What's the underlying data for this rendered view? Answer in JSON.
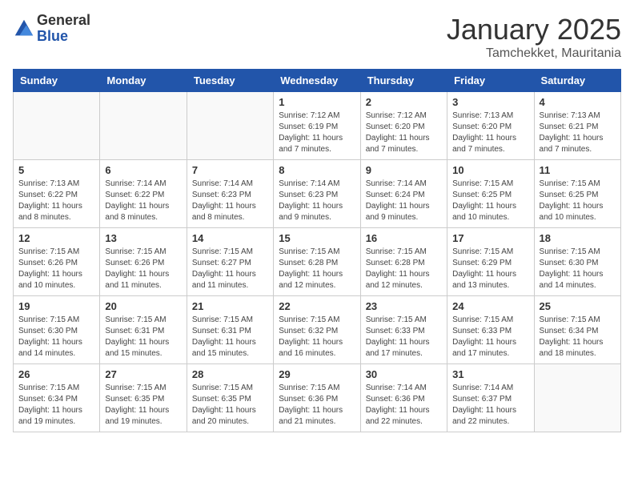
{
  "logo": {
    "general": "General",
    "blue": "Blue"
  },
  "title": "January 2025",
  "location": "Tamchekket, Mauritania",
  "days_of_week": [
    "Sunday",
    "Monday",
    "Tuesday",
    "Wednesday",
    "Thursday",
    "Friday",
    "Saturday"
  ],
  "weeks": [
    [
      {
        "day": "",
        "info": ""
      },
      {
        "day": "",
        "info": ""
      },
      {
        "day": "",
        "info": ""
      },
      {
        "day": "1",
        "info": "Sunrise: 7:12 AM\nSunset: 6:19 PM\nDaylight: 11 hours\nand 7 minutes."
      },
      {
        "day": "2",
        "info": "Sunrise: 7:12 AM\nSunset: 6:20 PM\nDaylight: 11 hours\nand 7 minutes."
      },
      {
        "day": "3",
        "info": "Sunrise: 7:13 AM\nSunset: 6:20 PM\nDaylight: 11 hours\nand 7 minutes."
      },
      {
        "day": "4",
        "info": "Sunrise: 7:13 AM\nSunset: 6:21 PM\nDaylight: 11 hours\nand 7 minutes."
      }
    ],
    [
      {
        "day": "5",
        "info": "Sunrise: 7:13 AM\nSunset: 6:22 PM\nDaylight: 11 hours\nand 8 minutes."
      },
      {
        "day": "6",
        "info": "Sunrise: 7:14 AM\nSunset: 6:22 PM\nDaylight: 11 hours\nand 8 minutes."
      },
      {
        "day": "7",
        "info": "Sunrise: 7:14 AM\nSunset: 6:23 PM\nDaylight: 11 hours\nand 8 minutes."
      },
      {
        "day": "8",
        "info": "Sunrise: 7:14 AM\nSunset: 6:23 PM\nDaylight: 11 hours\nand 9 minutes."
      },
      {
        "day": "9",
        "info": "Sunrise: 7:14 AM\nSunset: 6:24 PM\nDaylight: 11 hours\nand 9 minutes."
      },
      {
        "day": "10",
        "info": "Sunrise: 7:15 AM\nSunset: 6:25 PM\nDaylight: 11 hours\nand 10 minutes."
      },
      {
        "day": "11",
        "info": "Sunrise: 7:15 AM\nSunset: 6:25 PM\nDaylight: 11 hours\nand 10 minutes."
      }
    ],
    [
      {
        "day": "12",
        "info": "Sunrise: 7:15 AM\nSunset: 6:26 PM\nDaylight: 11 hours\nand 10 minutes."
      },
      {
        "day": "13",
        "info": "Sunrise: 7:15 AM\nSunset: 6:26 PM\nDaylight: 11 hours\nand 11 minutes."
      },
      {
        "day": "14",
        "info": "Sunrise: 7:15 AM\nSunset: 6:27 PM\nDaylight: 11 hours\nand 11 minutes."
      },
      {
        "day": "15",
        "info": "Sunrise: 7:15 AM\nSunset: 6:28 PM\nDaylight: 11 hours\nand 12 minutes."
      },
      {
        "day": "16",
        "info": "Sunrise: 7:15 AM\nSunset: 6:28 PM\nDaylight: 11 hours\nand 12 minutes."
      },
      {
        "day": "17",
        "info": "Sunrise: 7:15 AM\nSunset: 6:29 PM\nDaylight: 11 hours\nand 13 minutes."
      },
      {
        "day": "18",
        "info": "Sunrise: 7:15 AM\nSunset: 6:30 PM\nDaylight: 11 hours\nand 14 minutes."
      }
    ],
    [
      {
        "day": "19",
        "info": "Sunrise: 7:15 AM\nSunset: 6:30 PM\nDaylight: 11 hours\nand 14 minutes."
      },
      {
        "day": "20",
        "info": "Sunrise: 7:15 AM\nSunset: 6:31 PM\nDaylight: 11 hours\nand 15 minutes."
      },
      {
        "day": "21",
        "info": "Sunrise: 7:15 AM\nSunset: 6:31 PM\nDaylight: 11 hours\nand 15 minutes."
      },
      {
        "day": "22",
        "info": "Sunrise: 7:15 AM\nSunset: 6:32 PM\nDaylight: 11 hours\nand 16 minutes."
      },
      {
        "day": "23",
        "info": "Sunrise: 7:15 AM\nSunset: 6:33 PM\nDaylight: 11 hours\nand 17 minutes."
      },
      {
        "day": "24",
        "info": "Sunrise: 7:15 AM\nSunset: 6:33 PM\nDaylight: 11 hours\nand 17 minutes."
      },
      {
        "day": "25",
        "info": "Sunrise: 7:15 AM\nSunset: 6:34 PM\nDaylight: 11 hours\nand 18 minutes."
      }
    ],
    [
      {
        "day": "26",
        "info": "Sunrise: 7:15 AM\nSunset: 6:34 PM\nDaylight: 11 hours\nand 19 minutes."
      },
      {
        "day": "27",
        "info": "Sunrise: 7:15 AM\nSunset: 6:35 PM\nDaylight: 11 hours\nand 19 minutes."
      },
      {
        "day": "28",
        "info": "Sunrise: 7:15 AM\nSunset: 6:35 PM\nDaylight: 11 hours\nand 20 minutes."
      },
      {
        "day": "29",
        "info": "Sunrise: 7:15 AM\nSunset: 6:36 PM\nDaylight: 11 hours\nand 21 minutes."
      },
      {
        "day": "30",
        "info": "Sunrise: 7:14 AM\nSunset: 6:36 PM\nDaylight: 11 hours\nand 22 minutes."
      },
      {
        "day": "31",
        "info": "Sunrise: 7:14 AM\nSunset: 6:37 PM\nDaylight: 11 hours\nand 22 minutes."
      },
      {
        "day": "",
        "info": ""
      }
    ]
  ]
}
